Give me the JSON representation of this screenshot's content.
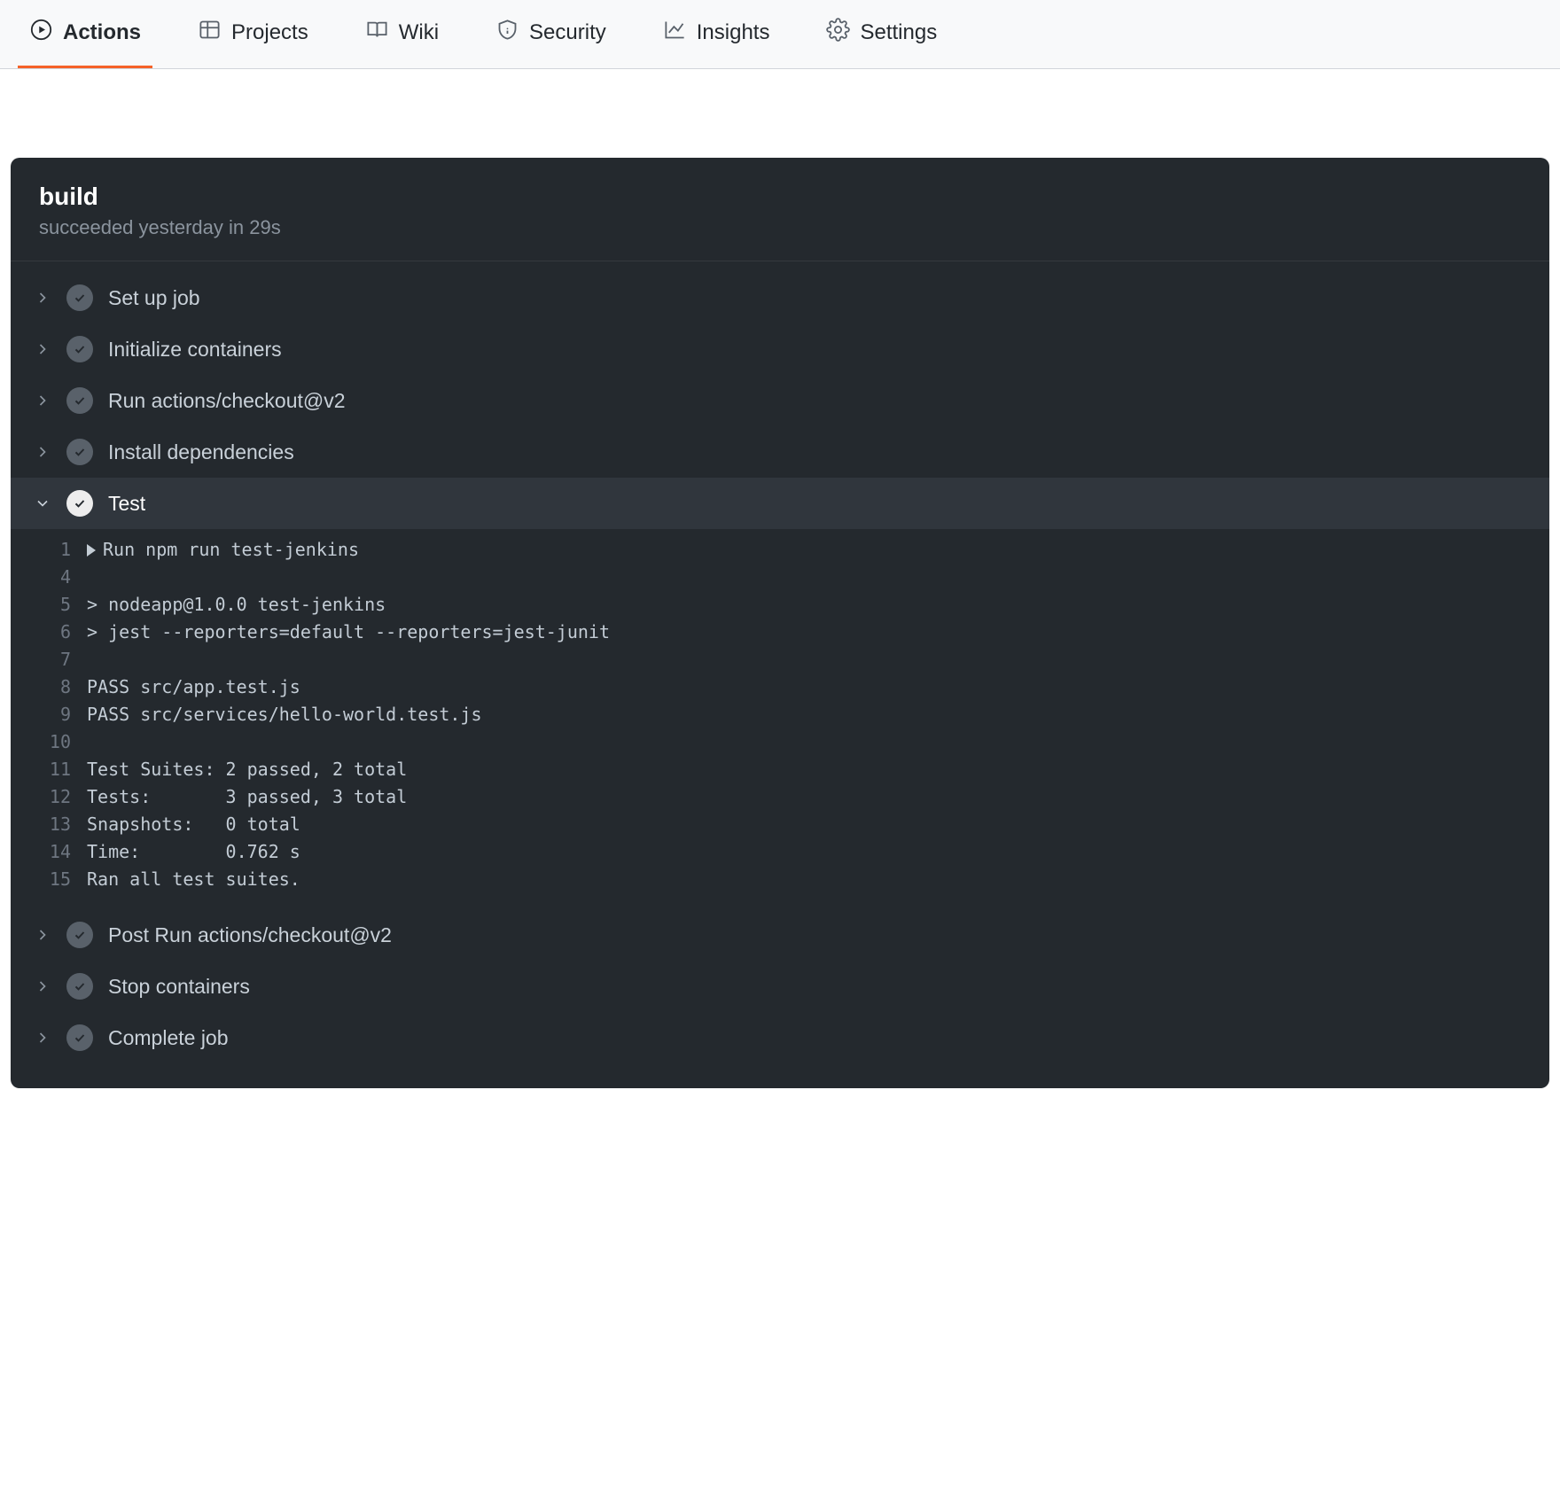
{
  "nav": {
    "items": [
      {
        "label": "Actions",
        "selected": true
      },
      {
        "label": "Projects",
        "selected": false
      },
      {
        "label": "Wiki",
        "selected": false
      },
      {
        "label": "Security",
        "selected": false
      },
      {
        "label": "Insights",
        "selected": false
      },
      {
        "label": "Settings",
        "selected": false
      }
    ]
  },
  "job": {
    "title": "build",
    "subtitle": "succeeded yesterday in 29s"
  },
  "steps": [
    {
      "label": "Set up job",
      "expanded": false
    },
    {
      "label": "Initialize containers",
      "expanded": false
    },
    {
      "label": "Run actions/checkout@v2",
      "expanded": false
    },
    {
      "label": "Install dependencies",
      "expanded": false
    },
    {
      "label": "Test",
      "expanded": true
    },
    {
      "label": "Post Run actions/checkout@v2",
      "expanded": false
    },
    {
      "label": "Stop containers",
      "expanded": false
    },
    {
      "label": "Complete job",
      "expanded": false
    }
  ],
  "log": [
    {
      "n": "1",
      "text": "Run npm run test-jenkins",
      "caret": true
    },
    {
      "n": "4",
      "text": ""
    },
    {
      "n": "5",
      "text": "> nodeapp@1.0.0 test-jenkins"
    },
    {
      "n": "6",
      "text": "> jest --reporters=default --reporters=jest-junit"
    },
    {
      "n": "7",
      "text": ""
    },
    {
      "n": "8",
      "text": "PASS src/app.test.js"
    },
    {
      "n": "9",
      "text": "PASS src/services/hello-world.test.js"
    },
    {
      "n": "10",
      "text": ""
    },
    {
      "n": "11",
      "text": "Test Suites: 2 passed, 2 total"
    },
    {
      "n": "12",
      "text": "Tests:       3 passed, 3 total"
    },
    {
      "n": "13",
      "text": "Snapshots:   0 total"
    },
    {
      "n": "14",
      "text": "Time:        0.762 s"
    },
    {
      "n": "15",
      "text": "Ran all test suites."
    }
  ]
}
